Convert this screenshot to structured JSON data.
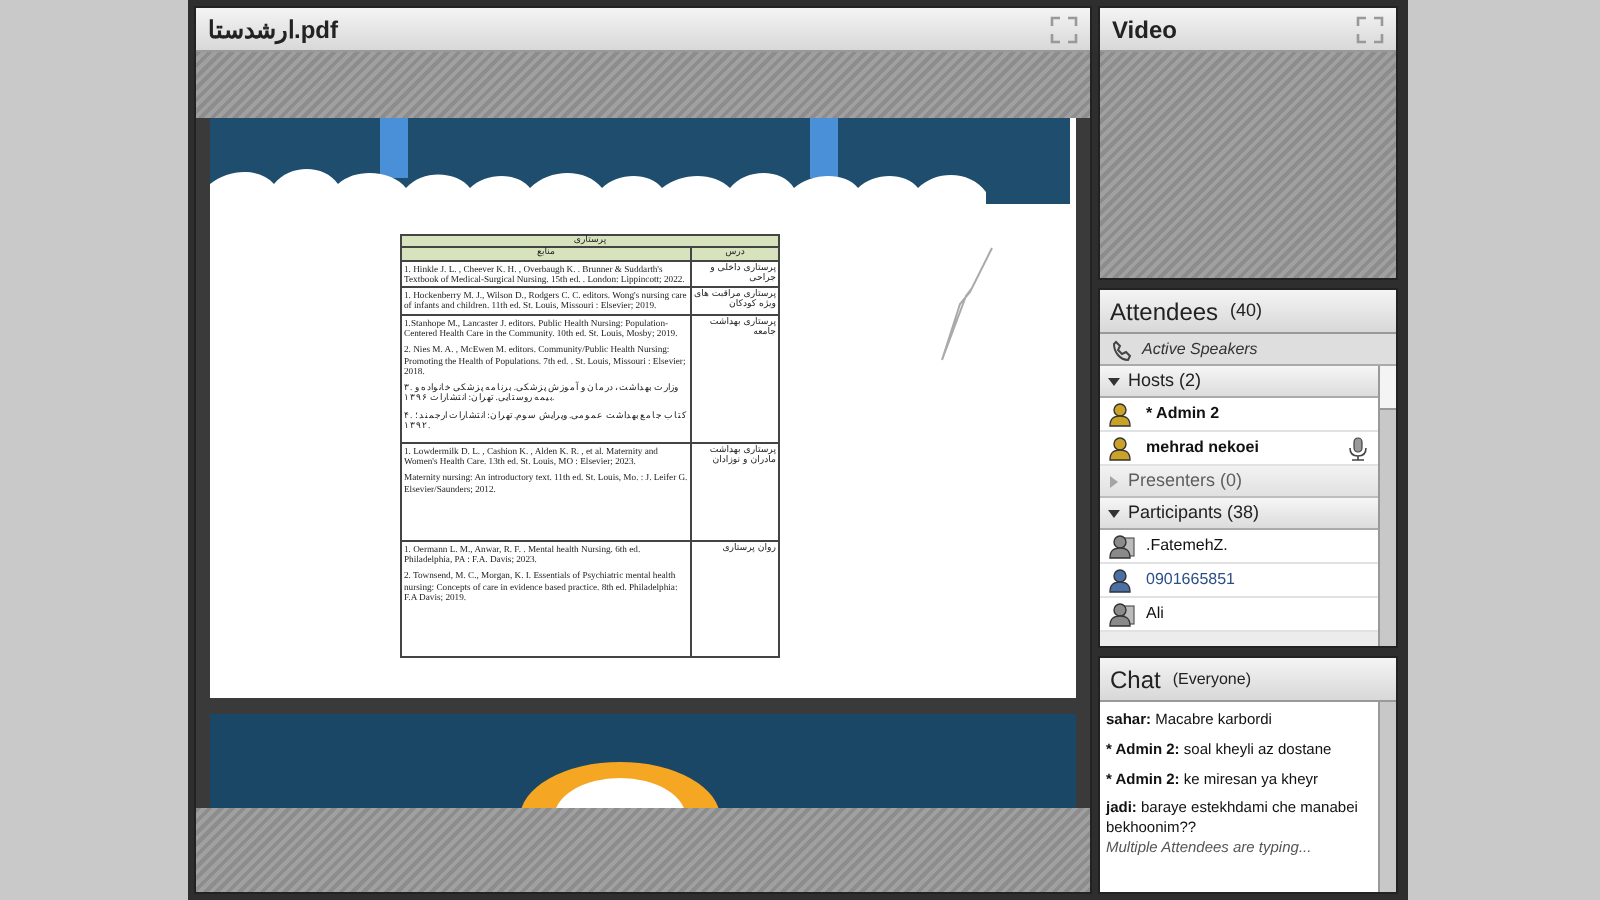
{
  "share_pod": {
    "title": "ارشدستا.pdf",
    "document": {
      "header": "پرستاری",
      "columns": [
        "درس",
        "منابع"
      ],
      "rows": [
        {
          "course": "پرستاری داخلی و جراحی",
          "references": [
            "1. Hinkle J. L. , Cheever K. H. , Overbaugh K. . Brunner & Suddarth's Textbook of Medical-Surgical Nursing. 15th ed. . London: Lippincott; 2022."
          ]
        },
        {
          "course": "پرستاری مراقبت های ویژه کودکان",
          "references": [
            "1. Hockenberry M. J., Wilson D., Rodgers C. C. editors. Wong's nursing care of infants and children. 11th ed. St. Louis, Missouri : Elsevier; 2019."
          ]
        },
        {
          "course": "پرستاری بهداشت جامعه",
          "references": [
            "1.Stanhope M., Lancaster J. editors. Public Health Nursing: Population-Centered Health Care in the Community. 10th ed. St. Louis, Mosby; 2019.",
            "2. Nies M. A. , McEwen M. editors. Community/Public Health Nursing: Promoting the Health of Populations. 7th ed. . St. Louis, Missouri : Elsevier; 2018.",
            "۳. وزارت بهداشت، درمان و آموزش پزشکی. برنامه پزشکی خانواده و بیمه روستایی. تهران: انتشارات ۱۳۹۶.",
            "۴. کتاب جامع بهداشت عمومی. ویرایش سوم. تهران: انتشارات ارجمند؛ ۱۳۹۲."
          ]
        },
        {
          "course": "پرستاری بهداشت مادران و نوزادان",
          "references": [
            "1. Lowdermilk D. L. , Cashion K. , Alden K. R. , et al. Maternity and Women's Health Care. 13th ed. St. Louis, MO : Elsevier; 2023.",
            "Maternity nursing: An introductory text. 11th ed. St. Louis, Mo. : J. Leifer G. Elsevier/Saunders; 2012."
          ]
        },
        {
          "course": "روان پرستاری",
          "references": [
            "1. Oermann L. M., Anwar, R. F. . Mental health Nursing. 6th ed. Philadelphia, PA : F.A. Davis; 2023.",
            "2. Townsend, M. C., Morgan, K. I. Essentials of Psychiatric mental health nursing: Concepts of care in evidence based practice. 8th ed. Philadelphia: F.A Davis; 2019."
          ]
        }
      ]
    }
  },
  "video_pod": {
    "title": "Video"
  },
  "attendees_pod": {
    "title": "Attendees",
    "count": "(40)",
    "active_speakers": "Active Speakers",
    "groups": [
      {
        "label": "Hosts (2)",
        "expanded": true,
        "members": [
          {
            "name": "* Admin 2",
            "kind": "host",
            "speaking": false
          },
          {
            "name": "mehrad nekoei",
            "kind": "host",
            "speaking": true
          }
        ]
      },
      {
        "label": "Presenters (0)",
        "expanded": false
      },
      {
        "label": "Participants (38)",
        "expanded": true,
        "members": [
          {
            "name": ".FatemehZ.",
            "kind": "participant",
            "speaking": false
          },
          {
            "name": "0901665851",
            "kind": "phone",
            "speaking": false
          },
          {
            "name": "Ali",
            "kind": "participant",
            "speaking": false
          }
        ]
      }
    ]
  },
  "chat_pod": {
    "title": "Chat",
    "audience": "(Everyone)",
    "messages": [
      {
        "sender": "sahar:",
        "text": "Macabre karbordi"
      },
      {
        "sender": "* Admin 2:",
        "text": "soal kheyli az dostane"
      },
      {
        "sender": "* Admin 2:",
        "text": "ke miresan ya kheyr"
      },
      {
        "sender": "jadi:",
        "text": "baraye estekhdami che manabei bekhoonim??"
      }
    ],
    "typing": "Multiple Attendees are typing..."
  }
}
